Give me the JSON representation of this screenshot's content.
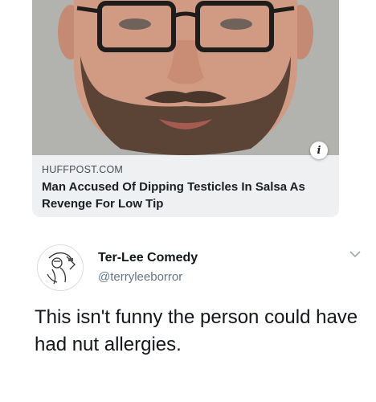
{
  "link_card": {
    "domain": "HUFFPOST.COM",
    "headline": "Man Accused Of Dipping Testicles In Salsa As Revenge For Low Tip",
    "info_glyph": "i",
    "image_icon": "mugshot-photo"
  },
  "author": {
    "name": "Ter-Lee Comedy",
    "handle": "@terryleeborror",
    "avatar_icon": "sketch-avatar-icon",
    "menu_icon": "chevron-down-icon"
  },
  "tweet": {
    "text": "This isn't funny the person could have had nut allergies."
  },
  "colors": {
    "card_background": "#eef0f2",
    "handle_gray": "#657786",
    "text_dark": "#14171a"
  }
}
